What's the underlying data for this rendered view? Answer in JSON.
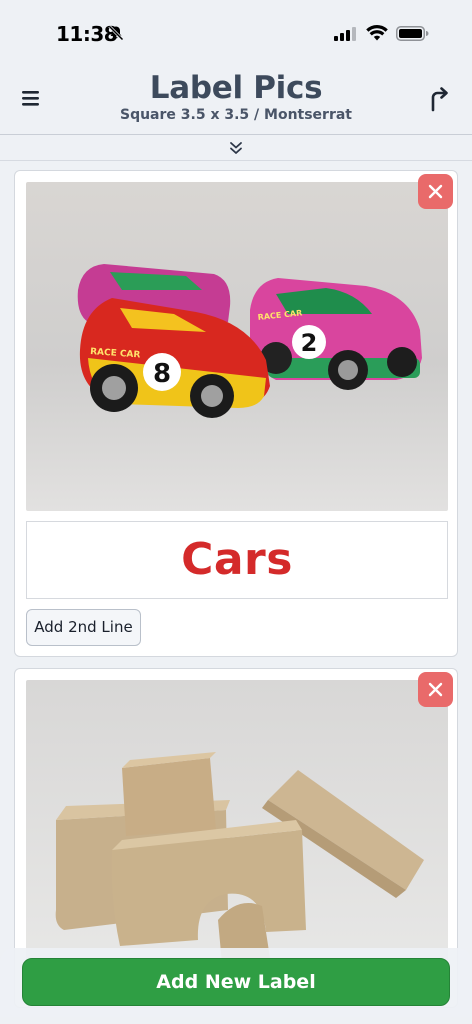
{
  "status_bar": {
    "time": "11:38"
  },
  "header": {
    "title": "Label Pics",
    "subtitle": "Square 3.5 x 3.5 / Montserrat",
    "menu_icon": "hamburger-menu-icon",
    "share_icon": "share-arrow-icon",
    "collapse_icon": "double-chevron-down-icon"
  },
  "cards": [
    {
      "photo_subject": "toy race cars",
      "photo_text": [
        "RACE CAR",
        "8",
        "RACE CAR",
        "2"
      ],
      "label": "Cars",
      "label_color": "#d42a2a",
      "add_line_label": "Add 2nd Line"
    },
    {
      "photo_subject": "wooden blocks"
    }
  ],
  "footer": {
    "add_new_label": "Add New Label"
  },
  "colors": {
    "accent_green": "#2f9e44",
    "remove_red": "#e96a6a",
    "title_gray": "#3d4a5c"
  }
}
